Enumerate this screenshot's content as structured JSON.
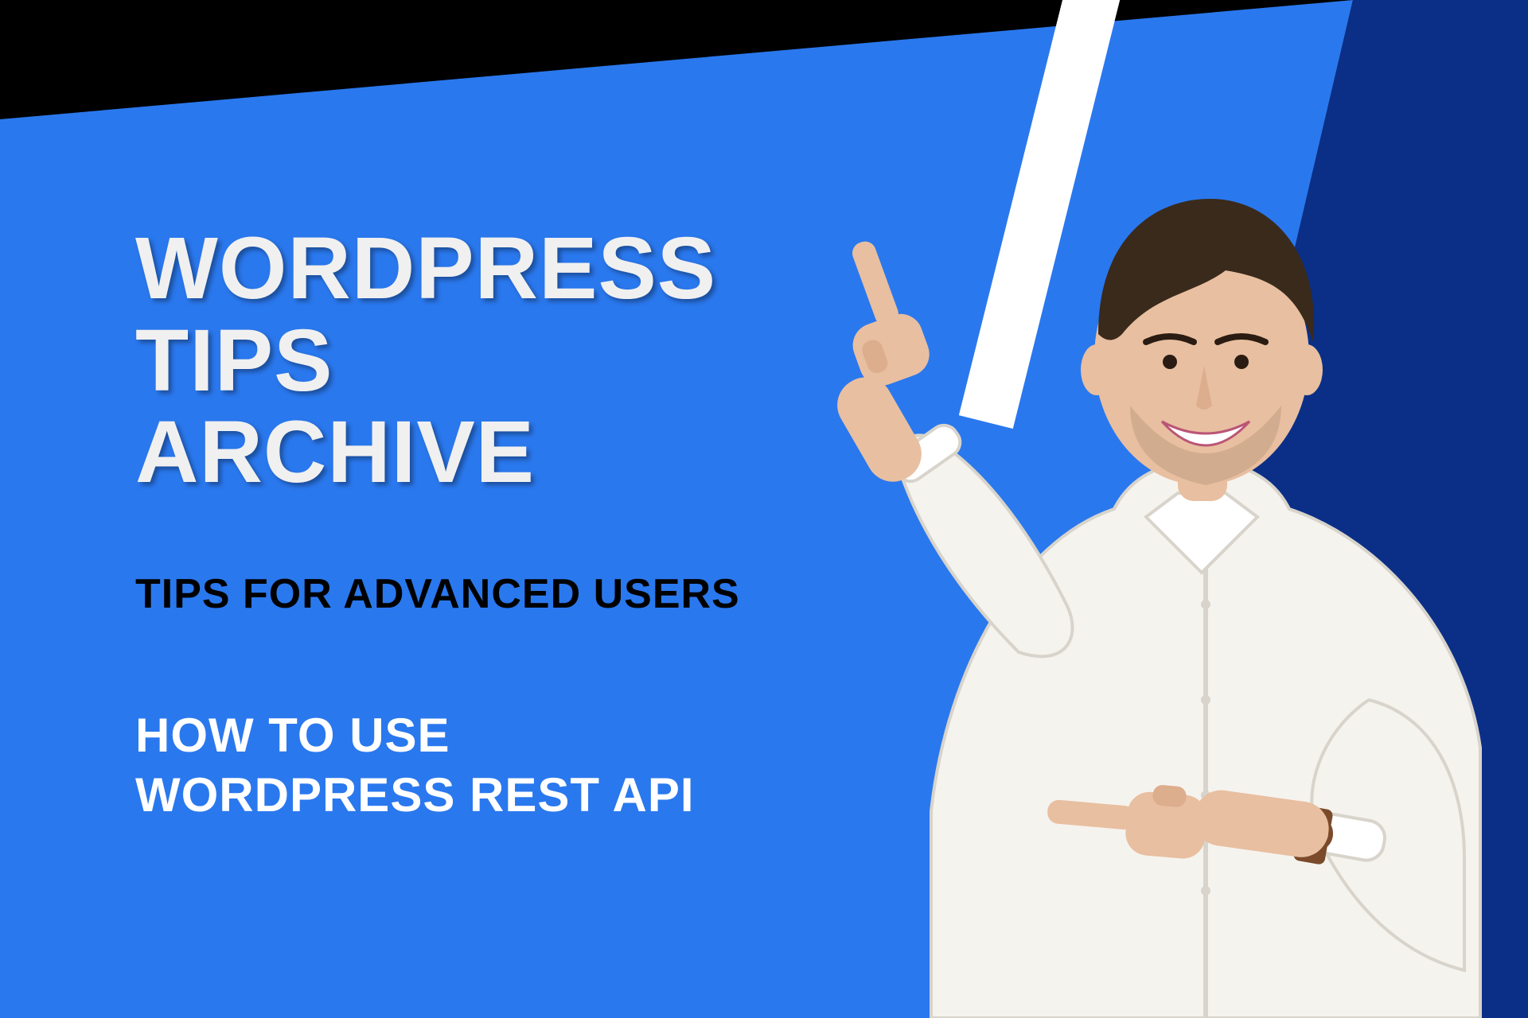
{
  "colors": {
    "light_blue": "#2a78ee",
    "dark_blue": "#0b2f86",
    "white": "#ffffff",
    "black": "#000000"
  },
  "text": {
    "title_line1": "WORDPRESS TIPS",
    "title_line2": "ARCHIVE",
    "subtitle": "TIPS FOR ADVANCED USERS",
    "topic_line1": "HOW TO USE",
    "topic_line2": "WORDPRESS REST API"
  },
  "person": {
    "description": "Smiling man in white button-down shirt pointing with both index fingers toward the text, wearing a brown leather-strap wristwatch",
    "shirt_color": "#f5f3ee",
    "hair_color": "#3a2a1c",
    "skin_tone": "#e8bfa0",
    "watch_strap": "#7a4a2a"
  }
}
